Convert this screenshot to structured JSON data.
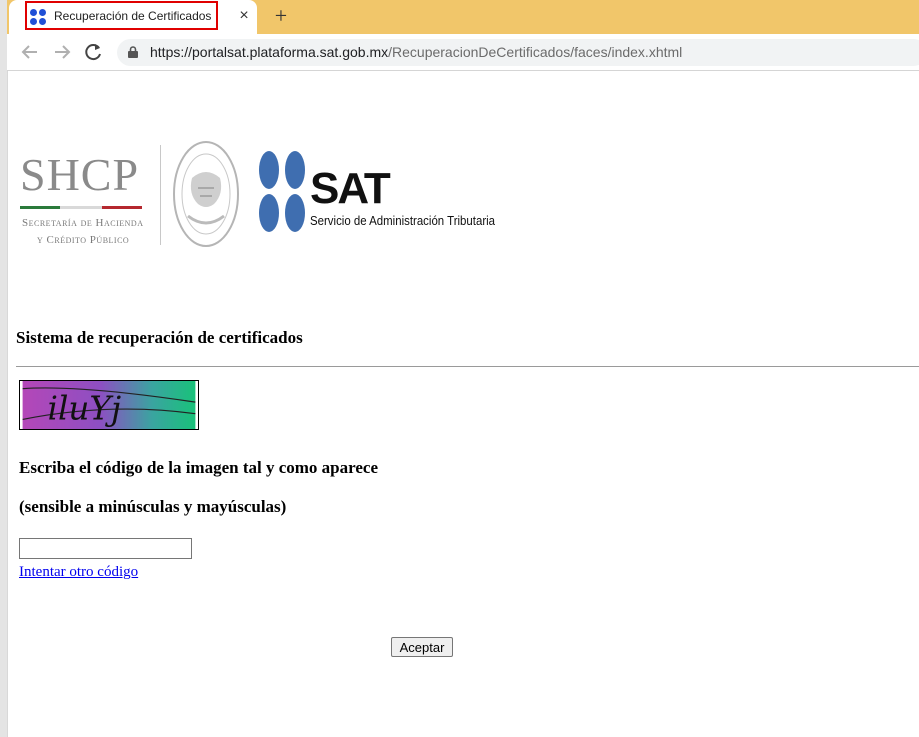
{
  "browser": {
    "tab": {
      "title": "Recuperación de Certificados",
      "close_glyph": "×",
      "favicon": "sat-dots-icon"
    },
    "new_tab_glyph": "+",
    "url": {
      "host": "https://portalsat.plataforma.sat.gob.mx",
      "path": "/RecuperacionDeCertificados/faces/index.xhtml"
    },
    "colors": {
      "tabstrip": "#f1c66a",
      "highlight": "#e00000"
    }
  },
  "logos": {
    "shcp": {
      "word": "SHCP",
      "line1": "Secretaría de Hacienda",
      "line2": "y Crédito Público"
    },
    "sat": {
      "word": "SAT",
      "subtitle": "Servicio de Administración Tributaria"
    }
  },
  "page": {
    "heading": "Sistema de recuperación de certificados",
    "captcha_text": "iluYj",
    "instruction_1": "Escriba el código de la imagen tal y como aparece",
    "instruction_2": "(sensible a minúsculas y mayúsculas)",
    "code_input_value": "",
    "retry_link": "Intentar otro código",
    "accept_button": "Aceptar"
  }
}
